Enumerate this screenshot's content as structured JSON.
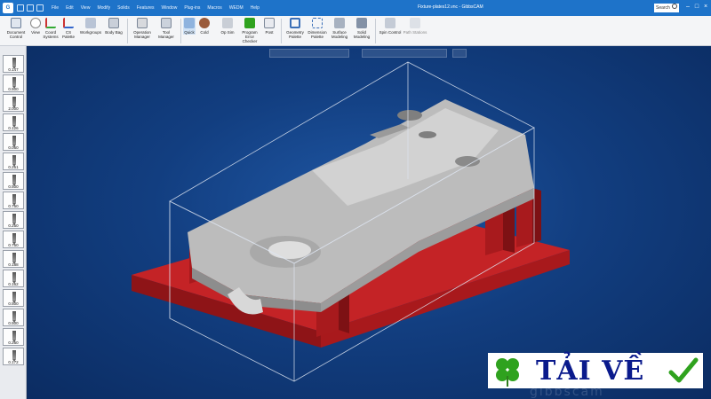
{
  "app": {
    "logo_letter": "G",
    "window_title": "Fixture-plates12.vnc - GibbsCAM",
    "search_placeholder": "Search"
  },
  "menu": [
    "File",
    "Edit",
    "View",
    "Modify",
    "Solids",
    "Features",
    "Window",
    "Plug-ins",
    "Macros",
    "WEDM",
    "Help"
  ],
  "ribbon": {
    "document_control": "Document Control",
    "view": "View",
    "coord_systems": "Coord Systems",
    "cs_palette": "CS Palette",
    "workgroups": "Workgroups",
    "body_bag": "Body Bag",
    "operation_manager": "Operation Manager",
    "tool_manager": "Tool Manager",
    "quick": "Quick",
    "cold": "Cold",
    "op_sim": "Op Sim",
    "program_error_checker": "Program Error Checker",
    "post": "Post",
    "geometry_palette": "Geometry Palette",
    "dimension_palette": "Dimension Palette",
    "surface_modeling": "Surface Modeling",
    "solid_modeling": "Solid Modeling",
    "spin_control": "Spin Control",
    "path_stations": "Path Stations"
  },
  "tools": [
    "0.147",
    "0.500",
    "2.000",
    "0.126",
    "0.060",
    "0.251",
    "0.500",
    "0.750",
    "0.250",
    "0.750",
    "0.188",
    "0.162",
    "0.500",
    "0.500",
    "0.260",
    "0.172"
  ],
  "watermark": "gibbscam",
  "banner": {
    "text": "TẢI VỀ"
  },
  "colors": {
    "title_bar": "#1e73c9",
    "viewport_bg": "#123e80",
    "plate": "#c42326",
    "part": "#bcbcbc",
    "banner_text": "#0a1a8c",
    "check": "#2fa21e",
    "clover": "#2fa21e"
  }
}
